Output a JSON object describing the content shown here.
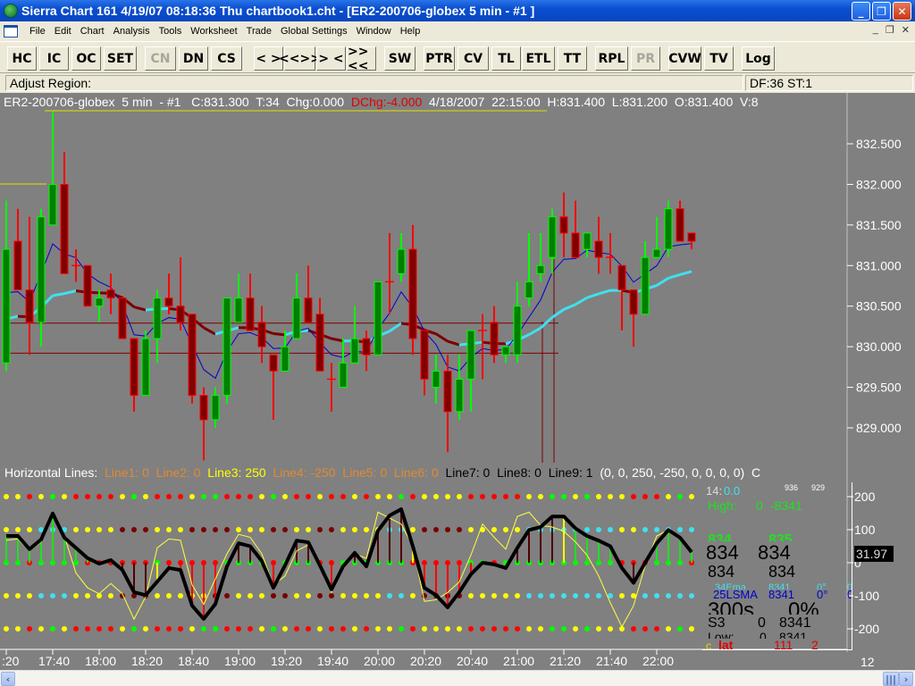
{
  "window": {
    "title": "Sierra Chart 161  4/19/07  08:18:36  Thu   chartbook1.cht - [ER2-200706-globex  5 min  - #1 ]"
  },
  "menu": [
    "File",
    "Edit",
    "Chart",
    "Analysis",
    "Tools",
    "Worksheet",
    "Trade",
    "Global Settings",
    "Window",
    "Help"
  ],
  "toolbar": [
    {
      "label": "HC",
      "enabled": true
    },
    {
      "label": "IC",
      "enabled": true
    },
    {
      "label": "OC",
      "enabled": true
    },
    {
      "label": "SET",
      "enabled": true
    },
    {
      "label": "CN",
      "enabled": false
    },
    {
      "label": "DN",
      "enabled": true
    },
    {
      "label": "CS",
      "enabled": true
    },
    {
      "label": "< >",
      "enabled": true
    },
    {
      "label": "<<>>",
      "enabled": true
    },
    {
      "label": "> <",
      "enabled": true
    },
    {
      "label": ">><<",
      "enabled": true
    },
    {
      "label": "SW",
      "enabled": true
    },
    {
      "label": "PTR",
      "enabled": true
    },
    {
      "label": "CV",
      "enabled": true
    },
    {
      "label": "TL",
      "enabled": true
    },
    {
      "label": "ETL",
      "enabled": true
    },
    {
      "label": "TT",
      "enabled": true
    },
    {
      "label": "RPL",
      "enabled": true
    },
    {
      "label": "PR",
      "enabled": false
    },
    {
      "label": "CVW",
      "enabled": true
    },
    {
      "label": "TV",
      "enabled": true
    },
    {
      "label": "Log",
      "enabled": true
    }
  ],
  "status": {
    "adjust": "Adjust Region:",
    "df": "DF:36  ST:1"
  },
  "info": {
    "symbol": "ER2-200706-globex  5 min  - #1   C:831.300  T:34  Chg:0.000  ",
    "dchg": "DChg:-4.000",
    "rest": "  4/18/2007  22:15:00  H:831.400  L:831.200  O:831.400  V:8"
  },
  "hlines": {
    "label": "Horizontal Lines:",
    "items": [
      {
        "text": "Line1: 0",
        "color": "#e08a30"
      },
      {
        "text": "Line2: 0",
        "color": "#e08a30"
      },
      {
        "text": "Line3: 250",
        "color": "#ffff00"
      },
      {
        "text": "Line4: -250",
        "color": "#e08a30"
      },
      {
        "text": "Line5: 0",
        "color": "#e08a30"
      },
      {
        "text": "Line6: 0",
        "color": "#e08a30"
      },
      {
        "text": "Line7: 0",
        "color": "#000000"
      },
      {
        "text": "Line8: 0",
        "color": "#000000"
      },
      {
        "text": "Line9: 1",
        "color": "#000000"
      }
    ],
    "values": "(0, 0, 250, -250, 0, 0, 0, 0)",
    "trail": "C"
  },
  "panel": {
    "r1": {
      "a": "14:",
      "b": "0.0",
      "c": "936",
      "d": "929"
    },
    "r2": {
      "a": "High:",
      "b": "0",
      "c": "-8341"
    },
    "r3": {
      "a": "834",
      "b": "835"
    },
    "r4": {
      "a": "834",
      "b": "834"
    },
    "r5": {
      "a": "834",
      "b": "834"
    },
    "r6": {
      "a": "34Ema",
      "b": "8341",
      "c": "0°",
      "d": "0"
    },
    "r7": {
      "a": "25LSMA",
      "b": "8341",
      "c": "0°",
      "d": "0"
    },
    "r8": {
      "a": "300s",
      "b": "0%"
    },
    "r9": {
      "a": "S3",
      "b": "0",
      "c": "8341"
    },
    "r10": {
      "a": "Low:",
      "b": "0",
      "c": "8341"
    },
    "r11": {
      "a": "c",
      "b": "lat",
      "c": "111",
      "d": "2"
    }
  },
  "osc_readout": "31.97",
  "axis_extra": "12",
  "colors": {
    "up_body": "#008000",
    "up_wick": "#00ff00",
    "down_body": "#800000",
    "down_wick": "#ff0000",
    "bg": "#808080",
    "fast_ma": "#0000cc",
    "slow_ma_up": "#40e0f0",
    "slow_ma_down": "#7a0000"
  },
  "chart_data": {
    "type": "candlestick",
    "price_axis": {
      "range": [
        828.7,
        832.9
      ],
      "ticks": [
        "832.500",
        "832.000",
        "831.500",
        "831.000",
        "830.500",
        "830.000",
        "829.500",
        "829.000"
      ]
    },
    "time_axis": {
      "ticks": [
        ":20",
        "17:40",
        "18:00",
        "18:20",
        "18:40",
        "19:00",
        "19:20",
        "19:40",
        "20:00",
        "20:20",
        "20:40",
        "21:00",
        "21:20",
        "21:40",
        "22:00"
      ]
    },
    "first_bar": "17:20",
    "bar_minutes": 5,
    "ohlc": [
      [
        829.8,
        831.8,
        829.7,
        831.2
      ],
      [
        831.3,
        831.7,
        830.7,
        830.7
      ],
      [
        830.7,
        831.6,
        829.9,
        830.3
      ],
      [
        830.3,
        831.7,
        830.0,
        831.6
      ],
      [
        831.5,
        832.9,
        831.5,
        832.0
      ],
      [
        832.0,
        832.4,
        830.9,
        830.9
      ],
      [
        831.0,
        831.2,
        830.8,
        831.0
      ],
      [
        831.0,
        831.0,
        830.5,
        830.5
      ],
      [
        830.5,
        830.7,
        830.3,
        830.6
      ],
      [
        830.7,
        830.9,
        830.4,
        830.6
      ],
      [
        830.6,
        830.6,
        830.1,
        830.1
      ],
      [
        830.1,
        830.1,
        829.2,
        829.4
      ],
      [
        829.4,
        830.2,
        829.4,
        830.1
      ],
      [
        830.1,
        830.7,
        829.8,
        830.6
      ],
      [
        830.6,
        830.9,
        830.4,
        830.5
      ],
      [
        830.5,
        831.1,
        830.2,
        830.3
      ],
      [
        830.4,
        830.4,
        829.3,
        829.4
      ],
      [
        829.4,
        829.5,
        828.6,
        829.1
      ],
      [
        829.1,
        829.5,
        829.0,
        829.4
      ],
      [
        829.4,
        830.6,
        829.3,
        830.6
      ],
      [
        830.3,
        830.9,
        830.3,
        830.6
      ],
      [
        830.6,
        830.9,
        830.2,
        830.2
      ],
      [
        830.3,
        830.5,
        829.8,
        830.0
      ],
      [
        829.9,
        829.9,
        829.1,
        829.7
      ],
      [
        829.7,
        830.2,
        829.7,
        830.0
      ],
      [
        830.1,
        830.9,
        830.1,
        830.6
      ],
      [
        830.6,
        831.0,
        830.3,
        830.3
      ],
      [
        830.4,
        830.6,
        829.7,
        829.7
      ],
      [
        829.6,
        829.8,
        829.2,
        829.6
      ],
      [
        829.5,
        830.1,
        829.5,
        829.8
      ],
      [
        829.8,
        830.5,
        829.8,
        830.1
      ],
      [
        830.1,
        830.2,
        829.7,
        829.9
      ],
      [
        829.9,
        830.8,
        829.9,
        830.8
      ],
      [
        830.8,
        831.4,
        830.4,
        830.8
      ],
      [
        830.9,
        831.4,
        830.8,
        831.2
      ],
      [
        831.2,
        831.5,
        829.9,
        830.1
      ],
      [
        830.2,
        830.2,
        829.4,
        829.6
      ],
      [
        829.5,
        829.9,
        829.3,
        829.7
      ],
      [
        829.7,
        829.9,
        828.7,
        829.2
      ],
      [
        829.2,
        829.9,
        829.1,
        829.6
      ],
      [
        829.6,
        830.2,
        829.2,
        830.2
      ],
      [
        830.2,
        830.4,
        829.6,
        830.2
      ],
      [
        830.3,
        830.5,
        829.8,
        829.9
      ],
      [
        829.9,
        830.0,
        829.8,
        830.0
      ],
      [
        829.9,
        830.8,
        829.8,
        830.5
      ],
      [
        830.6,
        831.4,
        830.5,
        830.8
      ],
      [
        830.9,
        831.4,
        830.8,
        831.0
      ],
      [
        831.1,
        831.7,
        830.9,
        831.6
      ],
      [
        831.6,
        831.9,
        831.1,
        831.4
      ],
      [
        831.4,
        831.8,
        831.1,
        831.1
      ],
      [
        831.2,
        831.4,
        831.1,
        831.4
      ],
      [
        831.3,
        831.6,
        830.9,
        831.1
      ],
      [
        831.1,
        831.4,
        830.9,
        831.1
      ],
      [
        831.0,
        831.0,
        830.2,
        830.7
      ],
      [
        830.7,
        830.7,
        830.0,
        830.4
      ],
      [
        830.4,
        831.3,
        830.4,
        831.1
      ],
      [
        831.1,
        831.6,
        831.1,
        831.2
      ],
      [
        831.2,
        831.8,
        831.1,
        831.7
      ],
      [
        831.7,
        831.8,
        831.3,
        831.3
      ],
      [
        831.4,
        831.4,
        831.2,
        831.3
      ]
    ],
    "horizontal_lines": [
      830.29,
      829.92
    ],
    "oscillator": {
      "axis_ticks": [
        "200",
        "100",
        "0",
        "-100",
        "-200"
      ],
      "levels": [
        200,
        100,
        0,
        -100,
        -200
      ],
      "main": [
        81,
        81,
        41,
        70,
        149,
        76,
        45,
        14,
        -3,
        8,
        -22,
        -89,
        -98,
        -57,
        -16,
        -22,
        -130,
        -170,
        -125,
        -11,
        59,
        50,
        5,
        -76,
        -8,
        67,
        62,
        -8,
        -81,
        -11,
        30,
        -11,
        97,
        143,
        162,
        50,
        -76,
        -98,
        -135,
        -89,
        -35,
        0,
        -5,
        -16,
        45,
        99,
        108,
        140,
        140,
        104,
        81,
        67,
        50,
        -16,
        -61,
        0,
        59,
        99,
        76,
        32
      ],
      "signal": [
        68,
        72,
        36,
        63,
        144,
        81,
        -31,
        -76,
        -94,
        -63,
        -94,
        -171,
        -103,
        45,
        72,
        68,
        -67,
        -126,
        -49,
        27,
        86,
        77,
        27,
        -67,
        -40,
        36,
        54,
        -9,
        -90,
        -18,
        27,
        13,
        153,
        135,
        117,
        50,
        -117,
        -112,
        -90,
        -58,
        23,
        117,
        77,
        41,
        140,
        153,
        113,
        108,
        95,
        63,
        23,
        -40,
        -121,
        -194,
        -130,
        -9,
        81,
        99,
        72,
        36
      ],
      "hist_colors": "ggggggggggmmmyrrrrrgmmgrgmmmrgmmmmmyrrrrrgggmmmmyggggrmggggg",
      "dot_rows": [
        "yyrygyrrrrygyrrryggrrrygyrryrryryygryyyyrrrrryyggygyyyrrrygy",
        "yyycccyyyymmmyyymmmmyyymmyymmyyyyccymmmmyyyyyccccccccyyccccc",
        "ggrggggrrrrrrgrrrrrggggrgggrrggggggrrrrrggrggggggggggrrrgggr",
        "yyycccyyyymmmyyyyymmyyymmyymmyyyyccymmmmyyyyyccccccccyyccccc",
        "yyrygyrrrrygyrrryggrrrygyrryrryryygryyyyrrrrryyggygyyyrrrygy"
      ]
    }
  }
}
